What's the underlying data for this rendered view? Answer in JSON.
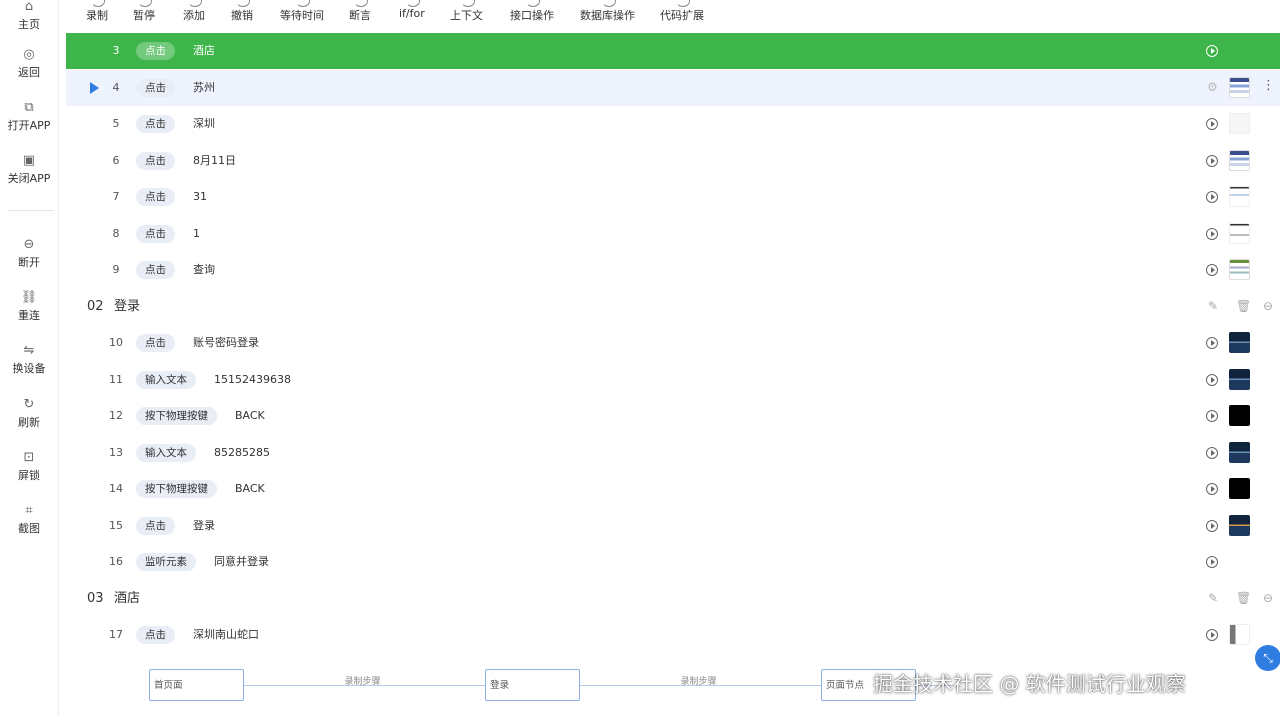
{
  "sidebar": {
    "items": [
      {
        "label": "主页",
        "icon": "home-icon"
      },
      {
        "label": "返回",
        "icon": "back-icon"
      },
      {
        "label": "打开APP",
        "icon": "open-app-icon"
      },
      {
        "label": "关闭APP",
        "icon": "close-app-icon"
      },
      {
        "label": "断开",
        "icon": "disconnect-icon"
      },
      {
        "label": "重连",
        "icon": "link-icon"
      },
      {
        "label": "换设备",
        "icon": "switch-icon"
      },
      {
        "label": "刷新",
        "icon": "refresh-icon"
      },
      {
        "label": "屏锁",
        "icon": "lock-icon"
      },
      {
        "label": "截图",
        "icon": "crop-icon"
      }
    ]
  },
  "toolbar": {
    "items": [
      "录制",
      "暂停",
      "添加",
      "撤销",
      "等待时间",
      "断言",
      "if/for",
      "上下文",
      "接口操作",
      "数据库操作",
      "代码扩展"
    ]
  },
  "steps": [
    {
      "num": "3",
      "action": "点击",
      "target": "酒店",
      "state": "running",
      "thumb": "none"
    },
    {
      "num": "4",
      "action": "点击",
      "target": "苏州",
      "state": "selected",
      "thumb": "app"
    },
    {
      "num": "5",
      "action": "点击",
      "target": "深圳",
      "thumb": "blank"
    },
    {
      "num": "6",
      "action": "点击",
      "target": "8月11日",
      "thumb": "app"
    },
    {
      "num": "7",
      "action": "点击",
      "target": "31",
      "thumb": "thin"
    },
    {
      "num": "8",
      "action": "点击",
      "target": "1",
      "thumb": "mid"
    },
    {
      "num": "9",
      "action": "点击",
      "target": "查询",
      "thumb": "list"
    }
  ],
  "groups": [
    {
      "num": "02",
      "name": "登录",
      "steps": [
        {
          "num": "10",
          "action": "点击",
          "target": "账号密码登录",
          "thumb": "dark"
        },
        {
          "num": "11",
          "action": "输入文本",
          "target": "15152439638",
          "thumb": "dark"
        },
        {
          "num": "12",
          "action": "按下物理按键",
          "target": "BACK",
          "thumb": "black"
        },
        {
          "num": "13",
          "action": "输入文本",
          "target": "85285285",
          "thumb": "dark"
        },
        {
          "num": "14",
          "action": "按下物理按键",
          "target": "BACK",
          "thumb": "black"
        },
        {
          "num": "15",
          "action": "点击",
          "target": "登录",
          "thumb": "gold"
        },
        {
          "num": "16",
          "action": "监听元素",
          "target": "同意并登录",
          "thumb": "none"
        }
      ]
    },
    {
      "num": "03",
      "name": "酒店",
      "steps": [
        {
          "num": "17",
          "action": "点击",
          "target": "深圳南山蛇口",
          "thumb": "small"
        }
      ]
    }
  ],
  "flow": {
    "nodes": [
      "首页面",
      "登录",
      "页面节点"
    ],
    "edges": [
      "录制步骤",
      "录制步骤"
    ]
  },
  "watermark": "掘金技术社区 @ 软件测试行业观察",
  "colors": {
    "running": "#3db54a",
    "selected": "#eef3fd",
    "accent": "#2f7de1",
    "tag": "#e8edf6"
  }
}
